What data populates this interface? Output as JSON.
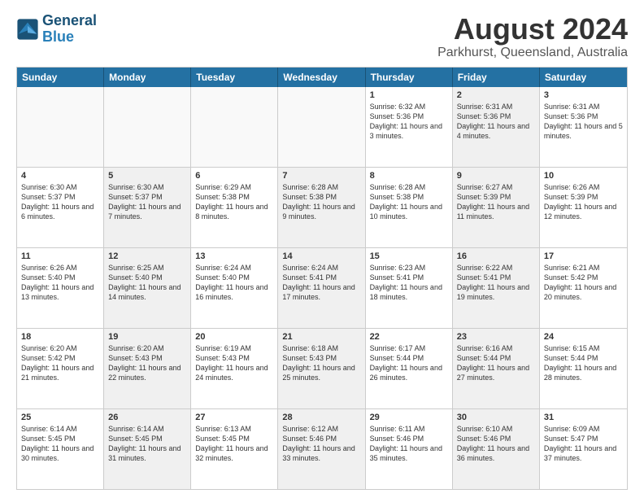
{
  "logo": {
    "line1": "General",
    "line2": "Blue"
  },
  "title": "August 2024",
  "location": "Parkhurst, Queensland, Australia",
  "header_days": [
    "Sunday",
    "Monday",
    "Tuesday",
    "Wednesday",
    "Thursday",
    "Friday",
    "Saturday"
  ],
  "weeks": [
    [
      {
        "day": "",
        "info": "",
        "shaded": false,
        "empty": true
      },
      {
        "day": "",
        "info": "",
        "shaded": false,
        "empty": true
      },
      {
        "day": "",
        "info": "",
        "shaded": false,
        "empty": true
      },
      {
        "day": "",
        "info": "",
        "shaded": false,
        "empty": true
      },
      {
        "day": "1",
        "info": "Sunrise: 6:32 AM\nSunset: 5:36 PM\nDaylight: 11 hours and 3 minutes.",
        "shaded": false,
        "empty": false
      },
      {
        "day": "2",
        "info": "Sunrise: 6:31 AM\nSunset: 5:36 PM\nDaylight: 11 hours and 4 minutes.",
        "shaded": true,
        "empty": false
      },
      {
        "day": "3",
        "info": "Sunrise: 6:31 AM\nSunset: 5:36 PM\nDaylight: 11 hours and 5 minutes.",
        "shaded": false,
        "empty": false
      }
    ],
    [
      {
        "day": "4",
        "info": "Sunrise: 6:30 AM\nSunset: 5:37 PM\nDaylight: 11 hours and 6 minutes.",
        "shaded": false,
        "empty": false
      },
      {
        "day": "5",
        "info": "Sunrise: 6:30 AM\nSunset: 5:37 PM\nDaylight: 11 hours and 7 minutes.",
        "shaded": true,
        "empty": false
      },
      {
        "day": "6",
        "info": "Sunrise: 6:29 AM\nSunset: 5:38 PM\nDaylight: 11 hours and 8 minutes.",
        "shaded": false,
        "empty": false
      },
      {
        "day": "7",
        "info": "Sunrise: 6:28 AM\nSunset: 5:38 PM\nDaylight: 11 hours and 9 minutes.",
        "shaded": true,
        "empty": false
      },
      {
        "day": "8",
        "info": "Sunrise: 6:28 AM\nSunset: 5:38 PM\nDaylight: 11 hours and 10 minutes.",
        "shaded": false,
        "empty": false
      },
      {
        "day": "9",
        "info": "Sunrise: 6:27 AM\nSunset: 5:39 PM\nDaylight: 11 hours and 11 minutes.",
        "shaded": true,
        "empty": false
      },
      {
        "day": "10",
        "info": "Sunrise: 6:26 AM\nSunset: 5:39 PM\nDaylight: 11 hours and 12 minutes.",
        "shaded": false,
        "empty": false
      }
    ],
    [
      {
        "day": "11",
        "info": "Sunrise: 6:26 AM\nSunset: 5:40 PM\nDaylight: 11 hours and 13 minutes.",
        "shaded": false,
        "empty": false
      },
      {
        "day": "12",
        "info": "Sunrise: 6:25 AM\nSunset: 5:40 PM\nDaylight: 11 hours and 14 minutes.",
        "shaded": true,
        "empty": false
      },
      {
        "day": "13",
        "info": "Sunrise: 6:24 AM\nSunset: 5:40 PM\nDaylight: 11 hours and 16 minutes.",
        "shaded": false,
        "empty": false
      },
      {
        "day": "14",
        "info": "Sunrise: 6:24 AM\nSunset: 5:41 PM\nDaylight: 11 hours and 17 minutes.",
        "shaded": true,
        "empty": false
      },
      {
        "day": "15",
        "info": "Sunrise: 6:23 AM\nSunset: 5:41 PM\nDaylight: 11 hours and 18 minutes.",
        "shaded": false,
        "empty": false
      },
      {
        "day": "16",
        "info": "Sunrise: 6:22 AM\nSunset: 5:41 PM\nDaylight: 11 hours and 19 minutes.",
        "shaded": true,
        "empty": false
      },
      {
        "day": "17",
        "info": "Sunrise: 6:21 AM\nSunset: 5:42 PM\nDaylight: 11 hours and 20 minutes.",
        "shaded": false,
        "empty": false
      }
    ],
    [
      {
        "day": "18",
        "info": "Sunrise: 6:20 AM\nSunset: 5:42 PM\nDaylight: 11 hours and 21 minutes.",
        "shaded": false,
        "empty": false
      },
      {
        "day": "19",
        "info": "Sunrise: 6:20 AM\nSunset: 5:43 PM\nDaylight: 11 hours and 22 minutes.",
        "shaded": true,
        "empty": false
      },
      {
        "day": "20",
        "info": "Sunrise: 6:19 AM\nSunset: 5:43 PM\nDaylight: 11 hours and 24 minutes.",
        "shaded": false,
        "empty": false
      },
      {
        "day": "21",
        "info": "Sunrise: 6:18 AM\nSunset: 5:43 PM\nDaylight: 11 hours and 25 minutes.",
        "shaded": true,
        "empty": false
      },
      {
        "day": "22",
        "info": "Sunrise: 6:17 AM\nSunset: 5:44 PM\nDaylight: 11 hours and 26 minutes.",
        "shaded": false,
        "empty": false
      },
      {
        "day": "23",
        "info": "Sunrise: 6:16 AM\nSunset: 5:44 PM\nDaylight: 11 hours and 27 minutes.",
        "shaded": true,
        "empty": false
      },
      {
        "day": "24",
        "info": "Sunrise: 6:15 AM\nSunset: 5:44 PM\nDaylight: 11 hours and 28 minutes.",
        "shaded": false,
        "empty": false
      }
    ],
    [
      {
        "day": "25",
        "info": "Sunrise: 6:14 AM\nSunset: 5:45 PM\nDaylight: 11 hours and 30 minutes.",
        "shaded": false,
        "empty": false
      },
      {
        "day": "26",
        "info": "Sunrise: 6:14 AM\nSunset: 5:45 PM\nDaylight: 11 hours and 31 minutes.",
        "shaded": true,
        "empty": false
      },
      {
        "day": "27",
        "info": "Sunrise: 6:13 AM\nSunset: 5:45 PM\nDaylight: 11 hours and 32 minutes.",
        "shaded": false,
        "empty": false
      },
      {
        "day": "28",
        "info": "Sunrise: 6:12 AM\nSunset: 5:46 PM\nDaylight: 11 hours and 33 minutes.",
        "shaded": true,
        "empty": false
      },
      {
        "day": "29",
        "info": "Sunrise: 6:11 AM\nSunset: 5:46 PM\nDaylight: 11 hours and 35 minutes.",
        "shaded": false,
        "empty": false
      },
      {
        "day": "30",
        "info": "Sunrise: 6:10 AM\nSunset: 5:46 PM\nDaylight: 11 hours and 36 minutes.",
        "shaded": true,
        "empty": false
      },
      {
        "day": "31",
        "info": "Sunrise: 6:09 AM\nSunset: 5:47 PM\nDaylight: 11 hours and 37 minutes.",
        "shaded": false,
        "empty": false
      }
    ]
  ]
}
